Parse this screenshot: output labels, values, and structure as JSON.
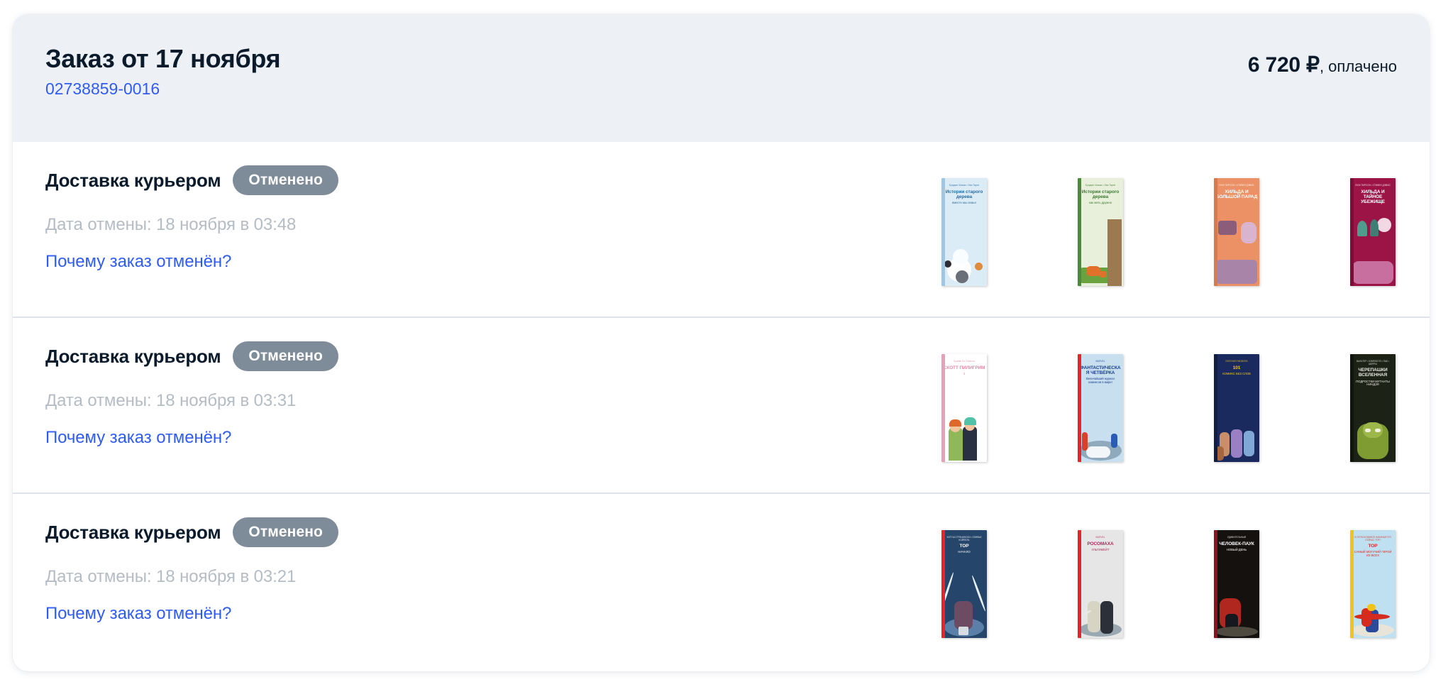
{
  "order": {
    "title": "Заказ от 17 ноября",
    "number": "02738859-0016",
    "amount": "6 720 ₽",
    "paid_label": ", оплачено"
  },
  "colors": {
    "link": "#2f5cf5",
    "title": "#0b1b2b",
    "badge_bg": "#7e8b99",
    "header_bg": "#edf1f5",
    "muted": "#b4bcc4",
    "divider": "#dde3e8"
  },
  "shipments": [
    {
      "title": "Доставка курьером",
      "status": "Отменено",
      "date": "Дата отмены: 18 ноября в 03:48",
      "link": "Почему заказ отменён?",
      "items": [
        {
          "title": "Истории старого дерева",
          "subtitle": "вместе мы семья",
          "byline": "Бриджит Ковако • Ева Тарле",
          "bg": "#dcecf7",
          "text": "#2a6d9e",
          "art": "#f3f9fd",
          "spine": "#9ec7e3",
          "style": "winter"
        },
        {
          "title": "Истории старого дерева",
          "subtitle": "как жить дружно",
          "byline": "Бриджит Ковако • Ева Тарле",
          "bg": "#e8f0dc",
          "text": "#3e7a32",
          "art": "#8fbf63",
          "spine": "#4b8a3a",
          "style": "forest"
        },
        {
          "title": "ХИЛЬДА И БОЛЬШОЙ ПАРАД",
          "subtitle": "",
          "byline": "ЛЮК ПИРСОН • СТИВЕН ДЭВИС",
          "bg": "#eb9165",
          "text": "#ffffff",
          "art": "#b58bb0",
          "spine": "#d97a4e",
          "style": "hilda-orange"
        },
        {
          "title": "ХИЛЬДА И ТАЙНОЕ УБЕЖИЩЕ",
          "subtitle": "",
          "byline": "ЛЮК ПИРСОН • СТИВЕН ДЭВИС",
          "bg": "#9c1346",
          "text": "#ffffff",
          "art": "#c56fa0",
          "spine": "#7d0d36",
          "style": "hilda-red"
        }
      ]
    },
    {
      "title": "Доставка курьером",
      "status": "Отменено",
      "date": "Дата отмены: 18 ноября в 03:31",
      "link": "Почему заказ отменён?",
      "items": [
        {
          "title": "СКОТТ ПИЛИГРИМ",
          "subtitle": "3",
          "byline": "Брайан Ли О'Мэлли",
          "bg": "#ffffff",
          "text": "#e08aa6",
          "art": "#f0c9a0",
          "spine": "#e8a0b8",
          "style": "scott"
        },
        {
          "title": "ФАНТАСТИЧЕСКАЯ ЧЕТВЁРКА",
          "subtitle": "Величайший журнал комиксов в мире!",
          "byline": "MARVEL",
          "bg": "#c8dff0",
          "text": "#1a3f8f",
          "art": "#9ab8cf",
          "spine": "#e62429",
          "style": "ff"
        },
        {
          "title": "101",
          "subtitle": "КОМИКС БЕЗ СЛОВ",
          "byline": "ЕВГЕНИЙ ЯКОВЛЕВ",
          "bg": "#1b2a5e",
          "text": "#f5c518",
          "art": "#e8a935",
          "spine": "#121d42",
          "style": "101"
        },
        {
          "title": "ЧЕРЕПАШКИ ВСЕЛЕННАЯ",
          "subtitle": "ПОДРОСТКИ МУТАНТЫ НИНДЗЯ",
          "byline": "ВАЛЬТЕР • КЭМПБЕЛЛ • ПАК • ШЕРРЫ",
          "bg": "#1d2216",
          "text": "#e8e8e0",
          "art": "#6f8a2a",
          "spine": "#12150e",
          "style": "tmnt"
        }
      ]
    },
    {
      "title": "Доставка курьером",
      "status": "Отменено",
      "date": "Дата отмены: 18 ноября в 03:21",
      "link": "Почему заказ отменён?",
      "items": [
        {
          "title": "ТОР",
          "subtitle": "НАЧАЛО",
          "byline": "ХИТУШ СТРАЧИНСКИ • ОЛИВЬЕ КОЙПЕЛЬ",
          "bg": "#25456b",
          "text": "#ffffff",
          "art": "#3f6b96",
          "spine": "#e62429",
          "style": "thor-modern"
        },
        {
          "title": "РОСОМАХА",
          "subtitle": "УЛЬТИМЕЙТ",
          "byline": "MARVEL",
          "bg": "#e6e6e6",
          "text": "#b02a5b",
          "art": "#b9c4cc",
          "spine": "#e62429",
          "style": "wolverine"
        },
        {
          "title": "ЧЕЛОВЕК-ПАУК",
          "subtitle": "НОВЫЙ ДЕНЬ",
          "byline": "УДИВИТЕЛЬНЫЙ",
          "bg": "#14110f",
          "text": "#ffffff",
          "art": "#6d6459",
          "spine": "#8b1220",
          "style": "spiderman"
        },
        {
          "title": "ТОР",
          "subtitle": "САМЫЙ МОГУЧИЙ ГЕРОЙ ИЗ ВСЕХ",
          "byline": "В ЭТОМ КОМИКСЕ НАЧИНАЕТСЯ СЕЙЧАС ТОР!",
          "bg": "#bfe0f0",
          "text": "#d62b1f",
          "art": "#d8e9f2",
          "spine": "#f0c419",
          "style": "thor-classic"
        }
      ]
    }
  ]
}
